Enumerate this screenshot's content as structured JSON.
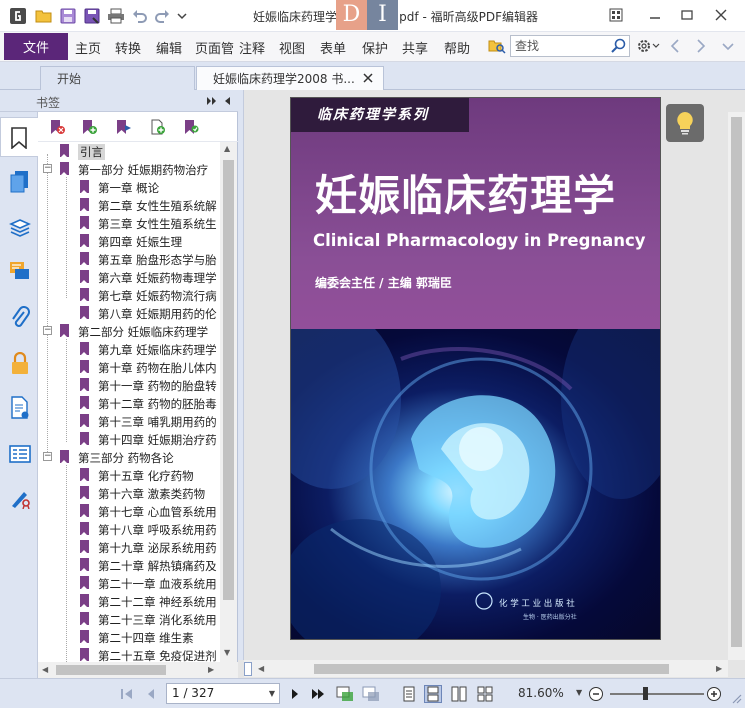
{
  "titlebar": {
    "title": "妊娠临床药理学2008  书签.pdf - 福昕高级PDF编辑器",
    "watermark_left": "D",
    "watermark_right": "I",
    "quick_access": [
      "app-logo-icon",
      "open-folder-icon",
      "save-icon",
      "save-as-icon",
      "print-icon",
      "undo-icon",
      "redo-icon",
      "customize-chevron-icon"
    ]
  },
  "ribbon": {
    "file": "文件",
    "menus": [
      "主页",
      "转换",
      "编辑",
      "页面管",
      "注释",
      "视图",
      "表单",
      "保护",
      "共享",
      "帮助"
    ],
    "search_placeholder": "查找"
  },
  "tabs": [
    {
      "label": "开始",
      "active": false
    },
    {
      "label": "妊娠临床药理学2008 书...",
      "active": true
    }
  ],
  "bookmarks": {
    "header": "书签",
    "items": [
      {
        "label": "引言",
        "level": 1,
        "selected": true
      },
      {
        "label": "第一部分  妊娠期药物治疗",
        "level": 0,
        "expanded": true
      },
      {
        "label": "第一章  概论",
        "level": 1
      },
      {
        "label": "第二章  女性生殖系统解",
        "level": 1
      },
      {
        "label": "第三章  女性生殖系统生",
        "level": 1
      },
      {
        "label": "第四章  妊娠生理",
        "level": 1
      },
      {
        "label": "第五章  胎盘形态学与胎",
        "level": 1
      },
      {
        "label": "第六章  妊娠药物毒理学",
        "level": 1
      },
      {
        "label": "第七章  妊娠药物流行病",
        "level": 1
      },
      {
        "label": "第八章  妊娠期用药的伦",
        "level": 1
      },
      {
        "label": "第二部分  妊娠临床药理学",
        "level": 0,
        "expanded": true
      },
      {
        "label": "第九章  妊娠临床药理学",
        "level": 1
      },
      {
        "label": "第十章  药物在胎儿体内",
        "level": 1
      },
      {
        "label": "第十一章  药物的胎盘转",
        "level": 1
      },
      {
        "label": "第十二章  药物的胚胎毒",
        "level": 1
      },
      {
        "label": "第十三章  哺乳期用药的",
        "level": 1
      },
      {
        "label": "第十四章  妊娠期治疗药",
        "level": 1
      },
      {
        "label": "第三部分  药物各论",
        "level": 0,
        "expanded": true
      },
      {
        "label": "第十五章  化疗药物",
        "level": 1
      },
      {
        "label": "第十六章  激素类药物",
        "level": 1
      },
      {
        "label": "第十七章  心血管系统用",
        "level": 1
      },
      {
        "label": "第十八章  呼吸系统用药",
        "level": 1
      },
      {
        "label": "第十九章  泌尿系统用药",
        "level": 1
      },
      {
        "label": "第二十章  解热镇痛药及",
        "level": 1
      },
      {
        "label": "第二十一章  血液系统用",
        "level": 1
      },
      {
        "label": "第二十二章  神经系统用",
        "level": 1
      },
      {
        "label": "第二十三章  消化系统用",
        "level": 1
      },
      {
        "label": "第二十四章  维生素",
        "level": 1
      },
      {
        "label": "第二十五章  免疫促进剂",
        "level": 1
      }
    ]
  },
  "cover": {
    "series": "临床药理学系列",
    "title": "妊娠临床药理学",
    "subtitle": "Clinical Pharmacology in Pregnancy",
    "editor": "编委会主任 / 主编    郭瑞臣",
    "publisher": "化 学 工 业 出 版 社",
    "publisher_sub": "生物 · 医药出版分社"
  },
  "statusbar": {
    "page_indicator": "1 / 327",
    "zoom": "81.60%"
  },
  "colors": {
    "brand_purple": "#5b2679",
    "bookmark_flag": "#7b3f87",
    "chrome_blue": "#dde4f2"
  }
}
